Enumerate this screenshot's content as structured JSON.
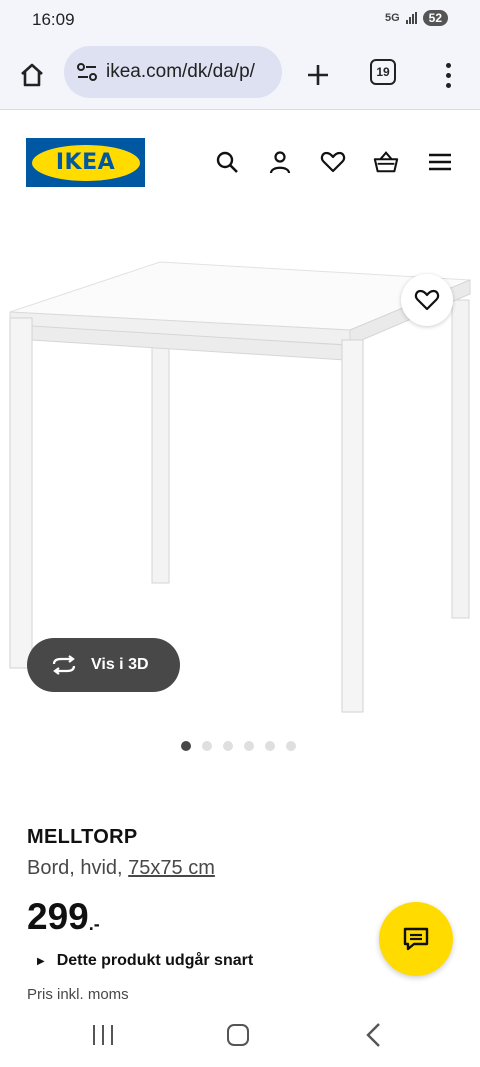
{
  "status_bar": {
    "time": "16:09",
    "network": "5G",
    "battery": "52"
  },
  "browser": {
    "url": "ikea.com/dk/da/p/",
    "tab_count": "19",
    "icons": [
      "home-icon",
      "site-info-icon",
      "plus-icon",
      "tabs-icon",
      "more-vert-icon"
    ]
  },
  "header": {
    "logo_text": "IKEA",
    "icons": [
      "search-icon",
      "user-icon",
      "heart-icon",
      "basket-icon",
      "hamburger-icon"
    ]
  },
  "gallery": {
    "view_3d_label": "Vis i 3D",
    "dot_count": 6,
    "active_index": 0
  },
  "product": {
    "name": "MELLTORP",
    "description": "Bord, hvid,",
    "size": "75x75 cm",
    "price": "299",
    "price_suffix": ".-",
    "notice": "Dette produkt udgår snart",
    "vat_note": "Pris inkl. moms"
  },
  "colors": {
    "ikea_blue": "#0058a3",
    "ikea_yellow": "#ffdb00",
    "pill_dark": "#484848"
  }
}
